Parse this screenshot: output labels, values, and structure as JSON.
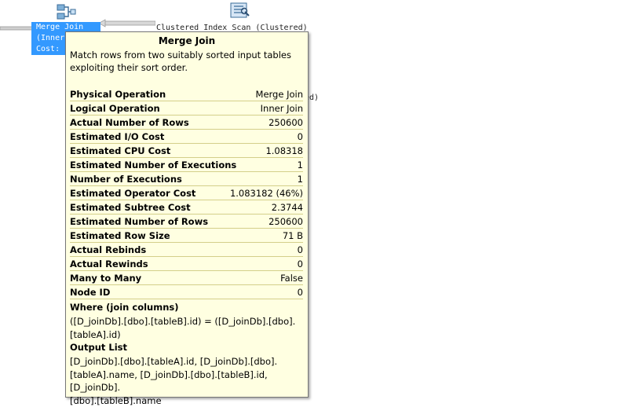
{
  "canvas": {
    "merge_node_lines": [
      "Merge Join",
      "(Inner",
      "Cost:"
    ],
    "scan_label": "Clustered Index Scan (Clustered)",
    "scan_label_2": "ed)"
  },
  "tooltip": {
    "title": "Merge Join",
    "description_lines": [
      "Match rows from two suitably sorted input tables",
      "exploiting their sort order."
    ],
    "properties": [
      {
        "label": "Physical Operation",
        "value": "Merge Join"
      },
      {
        "label": "Logical Operation",
        "value": "Inner Join"
      },
      {
        "label": "Actual Number of Rows",
        "value": "250600"
      },
      {
        "label": "Estimated I/O Cost",
        "value": "0"
      },
      {
        "label": "Estimated CPU Cost",
        "value": "1.08318"
      },
      {
        "label": "Estimated Number of Executions",
        "value": "1"
      },
      {
        "label": "Number of Executions",
        "value": "1"
      },
      {
        "label": "Estimated Operator Cost",
        "value": "1.083182 (46%)"
      },
      {
        "label": "Estimated Subtree Cost",
        "value": "2.3744"
      },
      {
        "label": "Estimated Number of Rows",
        "value": "250600"
      },
      {
        "label": "Estimated Row Size",
        "value": "71 B"
      },
      {
        "label": "Actual Rebinds",
        "value": "0"
      },
      {
        "label": "Actual Rewinds",
        "value": "0"
      },
      {
        "label": "Many to Many",
        "value": "False"
      },
      {
        "label": "Node ID",
        "value": "0"
      }
    ],
    "where_heading": "Where (join columns)",
    "where_lines": [
      "([D_joinDb].[dbo].[tableB].id) = ([D_joinDb].[dbo].",
      "[tableA].id)"
    ],
    "output_heading": "Output List",
    "output_lines": [
      "[D_joinDb].[dbo].[tableA].id, [D_joinDb].[dbo].",
      "[tableA].name, [D_joinDb].[dbo].[tableB].id, [D_joinDb].",
      "[dbo].[tableB].name"
    ]
  },
  "icons": {
    "merge": "merge-join-icon",
    "scan": "clustered-index-scan-icon"
  },
  "colors": {
    "selection": "#3399ff",
    "tooltip_bg": "#ffffe1",
    "row_line": "#d4cf8a"
  }
}
